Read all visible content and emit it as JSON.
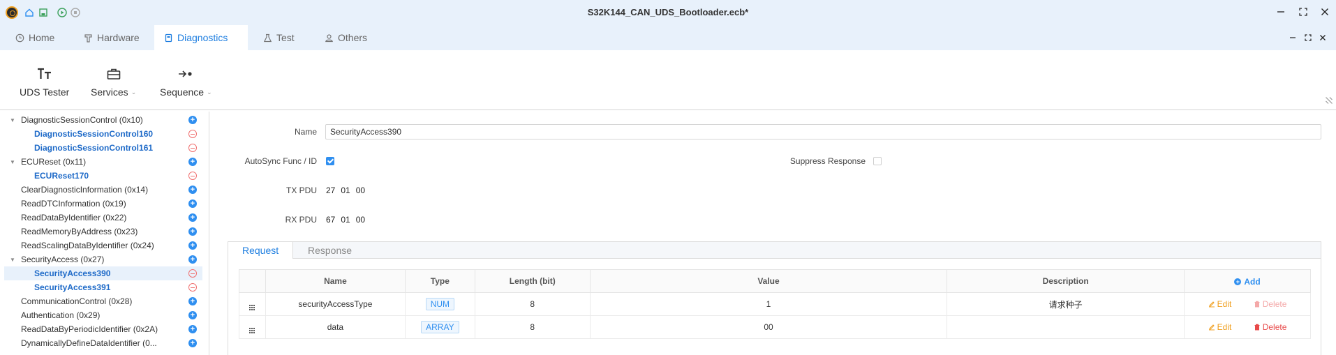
{
  "window": {
    "title": "S32K144_CAN_UDS_Bootloader.ecb*"
  },
  "tabs": [
    {
      "label": "Home"
    },
    {
      "label": "Hardware"
    },
    {
      "label": "Diagnostics"
    },
    {
      "label": "Test"
    },
    {
      "label": "Others"
    }
  ],
  "ribbon": {
    "uds_tester": "UDS Tester",
    "services": "Services",
    "sequence": "Sequence"
  },
  "tree": [
    {
      "label": "DiagnosticSessionControl (0x10)"
    },
    {
      "label": "DiagnosticSessionControl160"
    },
    {
      "label": "DiagnosticSessionControl161"
    },
    {
      "label": "ECUReset (0x11)"
    },
    {
      "label": "ECUReset170"
    },
    {
      "label": "ClearDiagnosticInformation (0x14)"
    },
    {
      "label": "ReadDTCInformation (0x19)"
    },
    {
      "label": "ReadDataByIdentifier (0x22)"
    },
    {
      "label": "ReadMemoryByAddress (0x23)"
    },
    {
      "label": "ReadScalingDataByIdentifier (0x24)"
    },
    {
      "label": "SecurityAccess (0x27)"
    },
    {
      "label": "SecurityAccess390"
    },
    {
      "label": "SecurityAccess391"
    },
    {
      "label": "CommunicationControl (0x28)"
    },
    {
      "label": "Authentication (0x29)"
    },
    {
      "label": "ReadDataByPeriodicIdentifier (0x2A)"
    },
    {
      "label": "DynamicallyDefineDataIdentifier (0..."
    }
  ],
  "form": {
    "name_label": "Name",
    "name_value": "SecurityAccess390",
    "autosync_label": "AutoSync Func / ID",
    "autosync_checked": true,
    "suppress_label": "Suppress Response",
    "suppress_checked": false,
    "tx_label": "TX PDU",
    "tx_bytes": [
      "27",
      "01",
      "00"
    ],
    "rx_label": "RX PDU",
    "rx_bytes": [
      "67",
      "01",
      "00"
    ]
  },
  "subtabs": {
    "request": "Request",
    "response": "Response"
  },
  "table": {
    "headers": [
      "Name",
      "Type",
      "Length (bit)",
      "Value",
      "Description"
    ],
    "add_label": "Add",
    "rows": [
      {
        "name": "securityAccessType",
        "type": "NUM",
        "length": "8",
        "value": "1",
        "description": "请求种子",
        "edit": "Edit",
        "delete": "Delete"
      },
      {
        "name": "data",
        "type": "ARRAY",
        "length": "8",
        "value": "00",
        "description": "",
        "edit": "Edit",
        "delete": "Delete"
      }
    ]
  },
  "colors": {
    "accent": "#1e7ee0",
    "titlebar_bg": "#e8f1fb",
    "edit": "#f0a020",
    "delete": "#e84a4a"
  }
}
